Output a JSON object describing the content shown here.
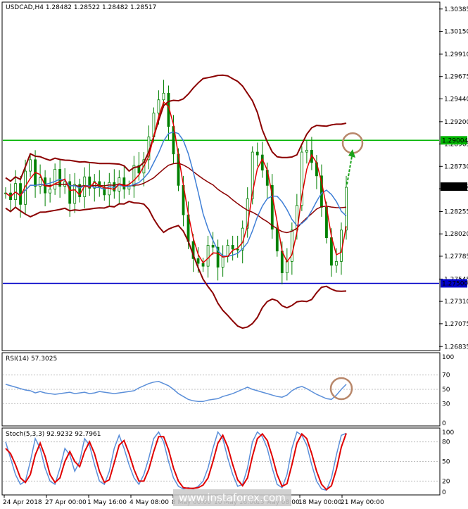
{
  "chart_data": [
    {
      "type": "candlestick",
      "title": "USDCAD,H4  1.28482 1.28522 1.28482 1.28517",
      "price_axis_ticks": [
        "1.30385",
        "1.30150",
        "1.29910",
        "1.29675",
        "1.29440",
        "1.29200",
        "1.28965",
        "1.28730",
        "1.28495",
        "1.28255",
        "1.28020",
        "1.27785",
        "1.27545",
        "1.27310",
        "1.27075",
        "1.26835"
      ],
      "ylim": [
        1.268,
        1.3045
      ],
      "current_price_label": "1.28517",
      "horizontal_lines": [
        {
          "value": 1.29004,
          "label": "1.29004",
          "color": "#00b400"
        },
        {
          "value": 1.275,
          "label": "1.27500",
          "color": "#0000c8"
        }
      ],
      "annotations": [
        "brown circle at target zone",
        "green upward arrow"
      ],
      "close_series": [
        1.2845,
        1.2838,
        1.2855,
        1.2833,
        1.2868,
        1.288,
        1.2852,
        1.2861,
        1.2845,
        1.2849,
        1.287,
        1.2852,
        1.2857,
        1.2834,
        1.2854,
        1.2841,
        1.2862,
        1.285,
        1.2857,
        1.2851,
        1.2843,
        1.2856,
        1.2847,
        1.2861,
        1.2849,
        1.2852,
        1.2874,
        1.2866,
        1.288,
        1.2904,
        1.2929,
        1.2943,
        1.295,
        1.2915,
        1.2886,
        1.2853,
        1.2822,
        1.2794,
        1.2776,
        1.2771,
        1.2768,
        1.279,
        1.2788,
        1.2767,
        1.2778,
        1.279,
        1.2786,
        1.2785,
        1.2808,
        1.2839,
        1.2888,
        1.2885,
        1.2869,
        1.2853,
        1.2807,
        1.2784,
        1.2761,
        1.2773,
        1.2806,
        1.2832,
        1.2888,
        1.289,
        1.2877,
        1.2863,
        1.283,
        1.2798,
        1.2769,
        1.2773,
        1.2806,
        1.2851
      ]
    },
    {
      "type": "line",
      "title": "RSI(14) 57.3025",
      "ylim": [
        0,
        100
      ],
      "levels": [
        70,
        50,
        30
      ],
      "axis_ticks": [
        "100",
        "70",
        "50",
        "30",
        "0"
      ],
      "series": [
        {
          "name": "RSI(14)",
          "color": "#5b8fd9",
          "values": [
            57,
            55,
            53,
            51,
            49,
            48,
            45,
            47,
            45,
            44,
            43,
            44,
            45,
            46,
            44,
            45,
            46,
            44,
            45,
            47,
            46,
            45,
            44,
            45,
            46,
            47,
            48,
            52,
            55,
            58,
            60,
            61,
            58,
            55,
            50,
            44,
            40,
            36,
            34,
            33,
            33,
            35,
            36,
            37,
            40,
            42,
            44,
            47,
            50,
            53,
            50,
            48,
            46,
            44,
            42,
            40,
            39,
            42,
            48,
            52,
            54,
            51,
            47,
            43,
            40,
            37,
            36,
            42,
            50,
            57
          ]
        }
      ]
    },
    {
      "type": "line",
      "title": "Stoch(5,3,3) 92.9232 92.7961",
      "ylim": [
        0,
        100
      ],
      "levels": [
        80,
        50,
        20
      ],
      "axis_ticks": [
        "100",
        "80",
        "50",
        "20",
        "0"
      ],
      "series": [
        {
          "name": "%K",
          "color": "#5b8fd9",
          "values": [
            80,
            55,
            30,
            15,
            20,
            50,
            85,
            70,
            40,
            20,
            15,
            40,
            70,
            60,
            35,
            50,
            85,
            75,
            45,
            20,
            15,
            35,
            70,
            90,
            70,
            45,
            25,
            15,
            30,
            55,
            85,
            95,
            80,
            50,
            25,
            12,
            8,
            10,
            8,
            12,
            20,
            40,
            70,
            95,
            85,
            55,
            30,
            12,
            15,
            40,
            80,
            95,
            88,
            70,
            40,
            15,
            10,
            30,
            70,
            95,
            90,
            75,
            45,
            20,
            8,
            6,
            25,
            60,
            90,
            93
          ]
        },
        {
          "name": "%D",
          "color": "#e00000",
          "values": [
            70,
            62,
            45,
            25,
            18,
            30,
            60,
            78,
            58,
            30,
            18,
            25,
            50,
            65,
            50,
            42,
            65,
            80,
            62,
            35,
            18,
            22,
            48,
            75,
            82,
            62,
            38,
            20,
            20,
            38,
            65,
            88,
            88,
            68,
            40,
            20,
            10,
            9,
            9,
            10,
            14,
            25,
            50,
            78,
            90,
            72,
            45,
            22,
            13,
            25,
            58,
            85,
            92,
            82,
            58,
            30,
            12,
            16,
            45,
            78,
            92,
            85,
            62,
            35,
            15,
            7,
            13,
            38,
            72,
            93
          ]
        }
      ]
    }
  ],
  "x_axis_labels": [
    "24 Apr 2018",
    "27 Apr 00:00",
    "1 May 16:00",
    "4 May 08:00",
    "8 May 00:00",
    "10 May 16:00",
    "15 May 08:00",
    "18 May 00:00",
    "21 May 00:00"
  ],
  "watermark": "www.instaforex.com",
  "colors": {
    "bollinger": "#8b0000",
    "ma_fast": "#e00000",
    "ma_slow": "#3f7fd6",
    "candle": "#008000",
    "support_line": "#0000c8",
    "resistance_line": "#00b400",
    "circle": "#b8876a"
  }
}
